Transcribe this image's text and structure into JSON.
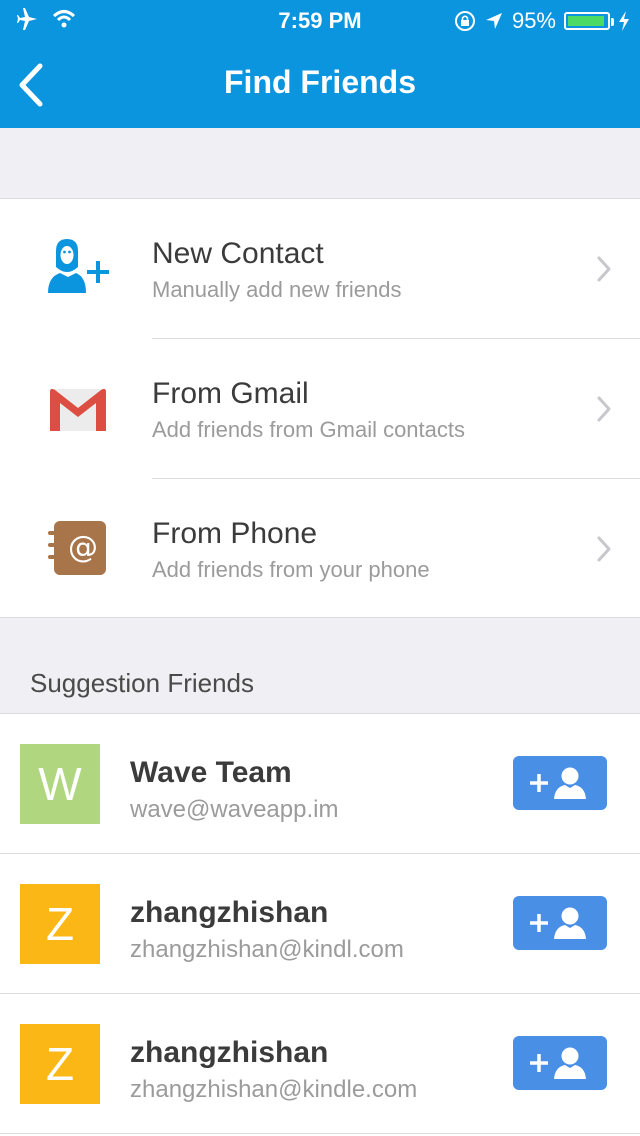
{
  "status_bar": {
    "time": "7:59 PM",
    "battery_percent": "95%",
    "battery_level": 0.95
  },
  "header": {
    "title": "Find Friends",
    "back_icon": "chevron-left-icon"
  },
  "options": [
    {
      "title": "New Contact",
      "subtitle": "Manually add new friends",
      "icon": "add-person-icon"
    },
    {
      "title": "From Gmail",
      "subtitle": "Add friends from Gmail contacts",
      "icon": "gmail-icon"
    },
    {
      "title": "From Phone",
      "subtitle": "Add friends from your phone",
      "icon": "address-book-icon"
    }
  ],
  "suggestions": {
    "label": "Suggestion Friends",
    "friends": [
      {
        "initial": "W",
        "name": "Wave Team",
        "email": "wave@waveapp.im",
        "color": "#b0d680"
      },
      {
        "initial": "Z",
        "name": "zhangzhishan",
        "email": "zhangzhishan@kindl.com",
        "color": "#fbb715"
      },
      {
        "initial": "Z",
        "name": "zhangzhishan",
        "email": "zhangzhishan@kindle.com",
        "color": "#fbb715"
      }
    ]
  },
  "colors": {
    "header": "#0b95de",
    "accent_button": "#4a8fe6",
    "gmail_red": "#dc4e41",
    "phone_brown": "#a8744a"
  }
}
